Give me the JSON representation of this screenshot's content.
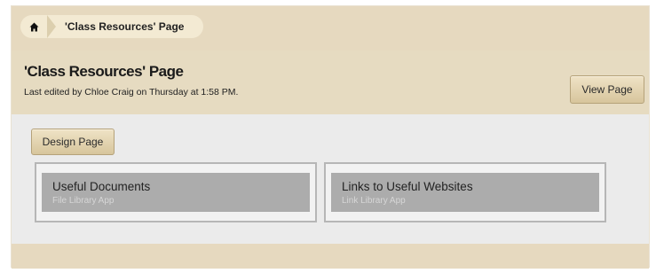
{
  "breadcrumb": {
    "home_icon": "home-icon",
    "current": "'Class Resources' Page"
  },
  "header": {
    "title": "'Class Resources' Page",
    "last_edited": "Last edited by Chloe Craig on Thursday at 1:58 PM.",
    "view_page_label": "View Page"
  },
  "content": {
    "design_page_label": "Design Page",
    "apps": [
      {
        "title": "Useful Documents",
        "subtitle": "File Library App"
      },
      {
        "title": "Links to Useful Websites",
        "subtitle": "Link Library App"
      }
    ]
  },
  "colors": {
    "tan_background": "#e6d9bf",
    "content_background": "#ebebeb",
    "app_box": "#acacac"
  }
}
